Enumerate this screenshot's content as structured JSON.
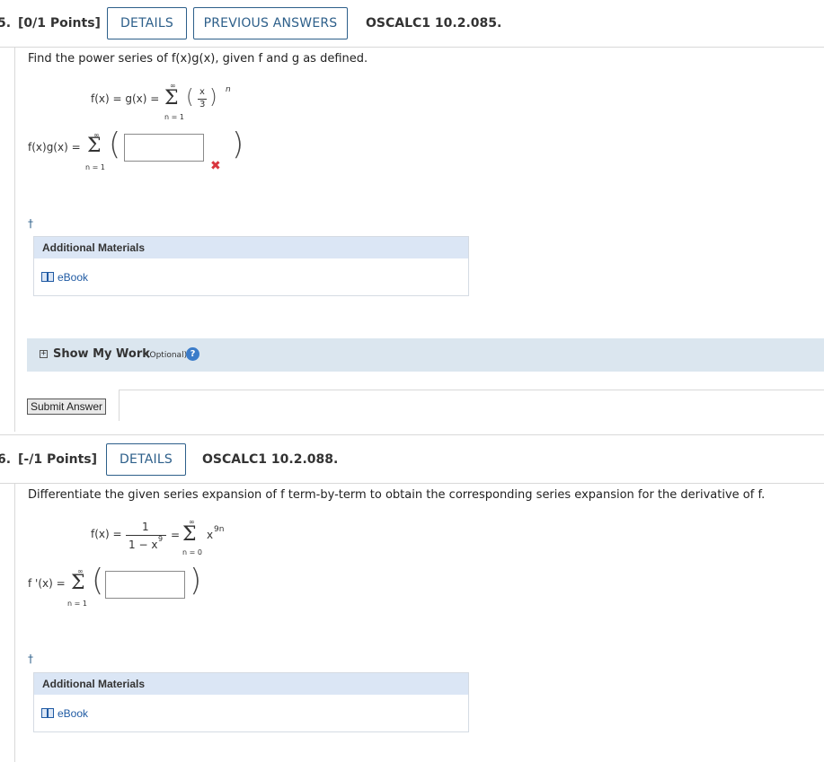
{
  "q5": {
    "number": "5.",
    "points": "[0/1 Points]",
    "details_label": "DETAILS",
    "previous_answers_label": "PREVIOUS ANSWERS",
    "code": "OSCALC1 10.2.085.",
    "prompt": "Find the power series of f(x)g(x), given f and g as defined.",
    "def_lhs": "f(x) = g(x) =",
    "sum_upper": "∞",
    "sum_lower": "n = 1",
    "frac_num": "x",
    "frac_den": "3",
    "exponent": "n",
    "answer_lhs": "f(x)g(x) =",
    "answer_value": "",
    "answer_status": "incorrect",
    "dagger": "†",
    "additional_materials": "Additional Materials",
    "ebook_label": "eBook",
    "show_my_work": "Show My Work",
    "optional": "(Optional)",
    "help": "?",
    "submit_label": "Submit Answer"
  },
  "q6": {
    "number": "6.",
    "points": "[-/1 Points]",
    "details_label": "DETAILS",
    "code": "OSCALC1 10.2.088.",
    "prompt": "Differentiate the given series expansion of f term-by-term to obtain the corresponding series expansion for the derivative of f.",
    "def_lhs": "f(x) =",
    "frac_num": "1",
    "frac_den": "1 − x",
    "frac_den_exp": "9",
    "equals": "=",
    "sum_upper": "∞",
    "sum_lower": "n = 0",
    "term": "x",
    "term_exp": "9n",
    "answer_lhs": "f '(x) =",
    "answer_sum_lower": "n = 1",
    "answer_value": "",
    "dagger": "†",
    "additional_materials": "Additional Materials",
    "ebook_label": "eBook"
  },
  "colors": {
    "accent": "#2d5f8a",
    "error": "#d9363e",
    "panel": "#dbe6f5"
  }
}
